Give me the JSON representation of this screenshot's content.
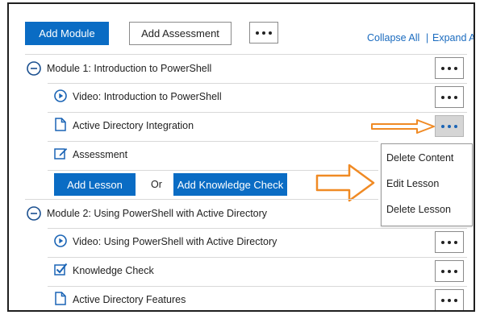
{
  "toolbar": {
    "add_module_label": "Add Module",
    "add_assessment_label": "Add Assessment",
    "collapse_all_label": "Collapse All",
    "separator": "|",
    "expand_all_label": "Expand All"
  },
  "modules": [
    {
      "title": "Module 1: Introduction to PowerShell",
      "expanded": true,
      "items": [
        {
          "type": "video",
          "icon": "play-circle-icon",
          "label": "Video: Introduction to PowerShell"
        },
        {
          "type": "document",
          "icon": "document-icon",
          "label": "Active Directory Integration"
        },
        {
          "type": "assessment",
          "icon": "edit-icon",
          "label": "Assessment"
        }
      ],
      "add_lesson_label": "Add Lesson",
      "or_label": "Or",
      "add_knowledge_check_label": "Add Knowledge Check"
    },
    {
      "title": "Module 2: Using PowerShell with Active Directory",
      "expanded": true,
      "items": [
        {
          "type": "video",
          "icon": "play-circle-icon",
          "label": "Video: Using PowerShell with Active Directory"
        },
        {
          "type": "knowledge-check",
          "icon": "checkbox-icon",
          "label": "Knowledge Check"
        },
        {
          "type": "document",
          "icon": "document-icon",
          "label": "Active Directory Features"
        }
      ]
    }
  ],
  "context_menu": {
    "items": [
      "Delete Content",
      "Edit Lesson",
      "Delete Lesson"
    ]
  },
  "colors": {
    "primary": "#0a6cc4",
    "link": "#1a6bbf",
    "annotation_arrow": "#f08a24"
  }
}
